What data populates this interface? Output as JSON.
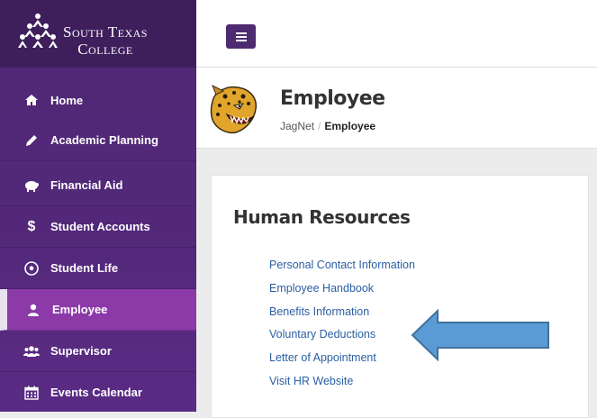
{
  "logo": {
    "line1": "South Texas",
    "line2": "College"
  },
  "sidebar": {
    "items": [
      {
        "label": "Home",
        "icon": "home-icon"
      },
      {
        "label": "Academic Planning",
        "icon": "pencil-icon"
      },
      {
        "label": "Financial Aid",
        "icon": "piggy-bank-icon"
      },
      {
        "label": "Student Accounts",
        "icon": "dollar-icon"
      },
      {
        "label": "Student Life",
        "icon": "soccer-ball-icon"
      },
      {
        "label": "Employee",
        "icon": "user-icon",
        "active": true
      },
      {
        "label": "Supervisor",
        "icon": "users-icon"
      },
      {
        "label": "Events Calendar",
        "icon": "calendar-icon"
      }
    ]
  },
  "topbar": {
    "menu_icon": "hamburger-icon"
  },
  "header": {
    "title": "Employee",
    "breadcrumb": {
      "root": "JagNet",
      "separator": "/",
      "current": "Employee"
    }
  },
  "card": {
    "title": "Human Resources",
    "links": [
      "Personal Contact Information",
      "Employee Handbook",
      "Benefits Information",
      "Voluntary Deductions",
      "Letter of Appointment",
      "Visit HR Website"
    ]
  },
  "colors": {
    "sidebar": "#53287a",
    "sidebar_active": "#8b3aa8",
    "link": "#2b5fa3",
    "arrow_fill": "#5b9bd5",
    "arrow_stroke": "#41719c"
  }
}
